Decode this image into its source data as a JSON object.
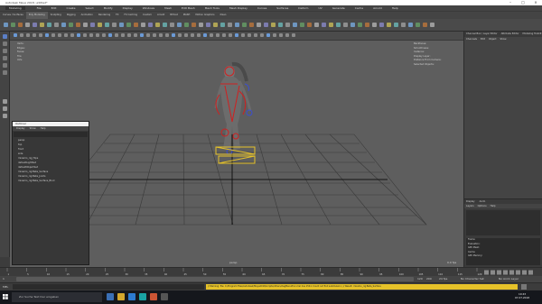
{
  "window": {
    "title": "Autodesk Maya 2018: untitled*"
  },
  "menus": [
    "File",
    "Edit",
    "Create",
    "Select",
    "Modify",
    "Display",
    "Windows",
    "Mesh",
    "Edit Mesh",
    "Mesh Tools",
    "Mesh Display",
    "Curves",
    "Surfaces",
    "Deform",
    "UV",
    "Generate",
    "Cache",
    "Arnold",
    "Help"
  ],
  "workspace_dropdown": "Modeling",
  "shelf_tabs": [
    "Curves / Surfaces",
    "Poly Modeling",
    "Sculpting",
    "Rigging",
    "Animation",
    "Rendering",
    "FX",
    "FX Caching",
    "Custom",
    "Arnold",
    "Bifrost",
    "MASH",
    "Motion Graphics",
    "XGen"
  ],
  "viewport": {
    "hud_left": [
      "Verts:",
      "Edges:",
      "Faces:",
      "Tris:",
      "UVs:"
    ],
    "hud_right": [
      "Backfaces:",
      "Smoothness:",
      "Instance:",
      "Display Layer:",
      "Distance From Camera:",
      "Selected Objects:"
    ],
    "camera_label": "persp",
    "fps": "0.0 fps"
  },
  "right_panel": {
    "tabs": [
      "Channel Box / Layer Editor",
      "Attribute Editor",
      "Modeling Toolkit"
    ],
    "menu": [
      "Channels",
      "Edit",
      "Object",
      "Show"
    ],
    "layers_tabs": [
      "Display",
      "Anim"
    ],
    "layers_menu": [
      "Layers",
      "Options",
      "Help"
    ],
    "info_labels": [
      "Frame:",
      "Evaluation:",
      "GPU Mesh:",
      "Cache:",
      "GPU Memory:"
    ]
  },
  "outliner": {
    "title": "Outliner",
    "menu": [
      "Display",
      "Show",
      "Help"
    ],
    "items": [
      "persp",
      "top",
      "front",
      "side",
      "mixamo_rig_Hips",
      "defaultLightSet",
      "defaultObjectSet",
      "mixamo_rig:Beta_Surface",
      "mixamo_rig:Beta_Joints",
      "mixamo_rig:Beta_Surface_Bind"
    ]
  },
  "timeline": {
    "ticks": [
      "1",
      "5",
      "10",
      "15",
      "20",
      "25",
      "30",
      "35",
      "40",
      "45",
      "50",
      "55",
      "60",
      "65",
      "70",
      "75",
      "80",
      "85",
      "90",
      "95",
      "100",
      "105",
      "110",
      "115",
      "120"
    ],
    "start": "1",
    "end": "120",
    "range_end": "200",
    "character_set": "No Character Set",
    "anim_layer": "No Anim Layer",
    "fps_label": "24 fps"
  },
  "command_line": {
    "label": "MEL",
    "warning": "// Warning: file: C:/Program Files/Autodesk/Maya2018/scripts/others/dagMenuProc.mel line 1541: Could not find subdivision / // Result: mixamo_rig:Beta_Surface"
  },
  "taskbar": {
    "search_placeholder": "Zur Suche Text hier eingeben",
    "time": "10:43",
    "date": "07.07.2018"
  },
  "colors": {
    "accent_yellow": "#e6c229",
    "joint_red": "#d02020",
    "joint_blue": "#3b4ed0",
    "grid": "#1c1c1c"
  }
}
